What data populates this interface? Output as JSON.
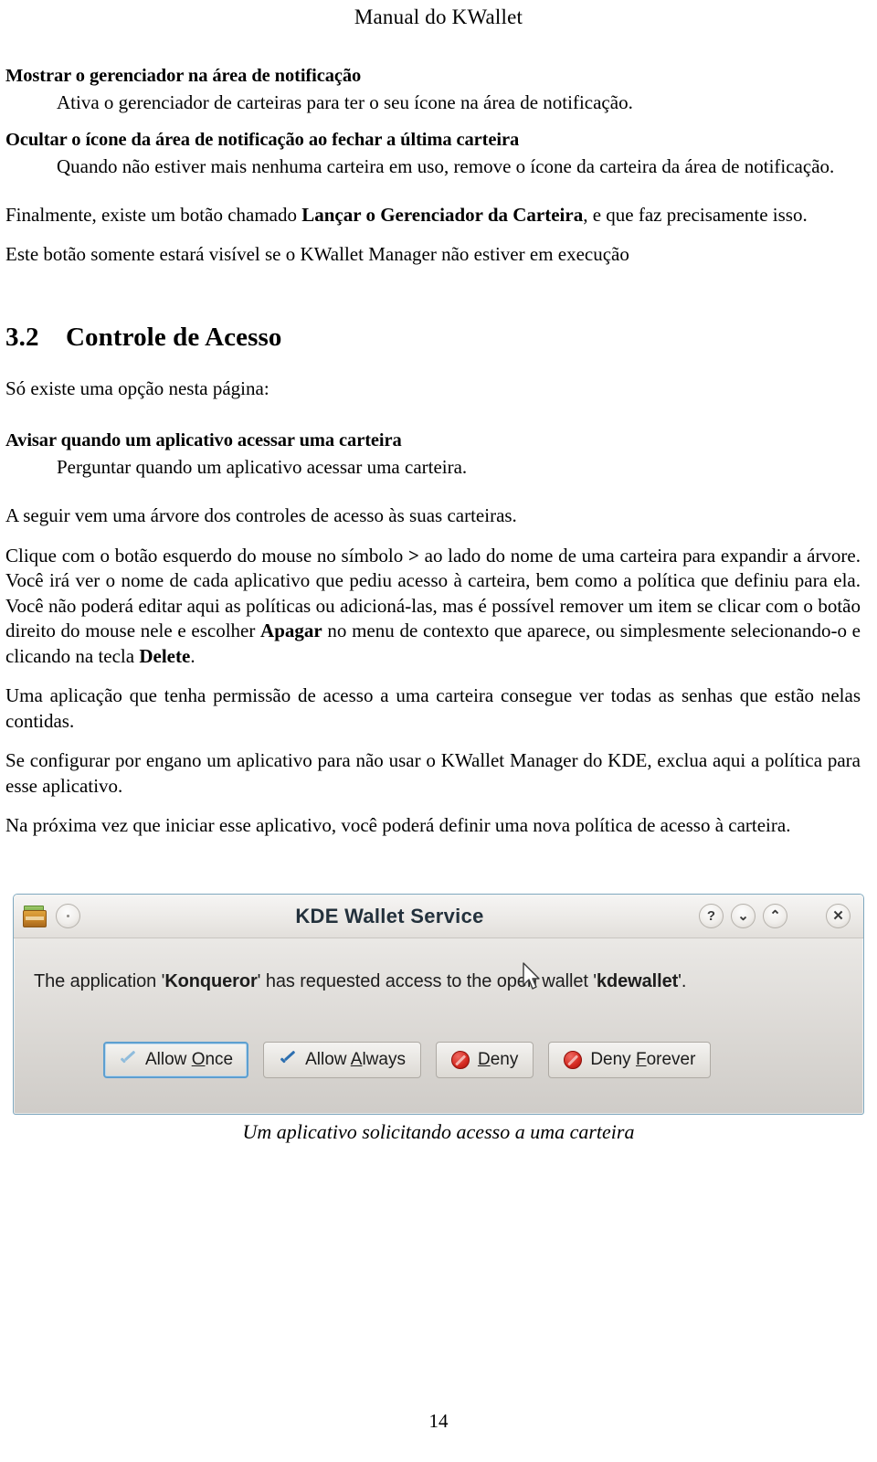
{
  "header": {
    "running_title": "Manual do KWallet"
  },
  "body": {
    "varlist": [
      {
        "term": "Mostrar o gerenciador na área de notificação",
        "definition": "Ativa o gerenciador de carteiras para ter o seu ícone na área de notificação."
      },
      {
        "term": "Ocultar o ícone da área de notificação ao fechar a última carteira",
        "definition": "Quando não estiver mais nenhuma carteira em uso, remove o ícone da carteira da área de notificação."
      }
    ],
    "para_final_1": "Finalmente, existe um botão chamado ",
    "para_final_bold": "Lançar o Gerenciador da Carteira",
    "para_final_2": ", e que faz precisamente isso.",
    "para_visible": "Este botão somente estará visível se o KWallet Manager não estiver em execução"
  },
  "section": {
    "number": "3.2",
    "title": "Controle de Acesso",
    "intro": "Só existe uma opção nesta página:",
    "option_term": "Avisar quando um aplicativo acessar uma carteira",
    "option_def": "Perguntar quando um aplicativo acessar uma carteira.",
    "para_tree": "A seguir vem uma árvore dos controles de acesso às suas carteiras.",
    "para_click_1": "Clique com o botão esquerdo do mouse no símbolo ",
    "para_click_symbol": ">",
    "para_click_2": " ao lado do nome de uma carteira para expandir a árvore. Você irá ver o nome de cada aplicativo que pediu acesso à carteira, bem como a política que definiu para ela. Você não poderá editar aqui as políticas ou adicioná-las, mas é possível remover um item se clicar com o botão direito do mouse nele e escolher ",
    "para_click_bold1": "Apagar",
    "para_click_3": " no menu de contexto que aparece, ou simplesmente selecionando-o e clicando na tecla ",
    "para_click_bold2": "Delete",
    "para_click_4": ".",
    "para_permission": "Uma aplicação que tenha permissão de acesso a uma carteira consegue ver todas as senhas que estão nelas contidas.",
    "para_misconfig": "Se configurar por engano um aplicativo para não usar o KWallet Manager do KDE, exclua aqui a política para esse aplicativo.",
    "para_nexttime": "Na próxima vez que iniciar esse aplicativo, você poderá definir uma nova política de acesso à carteira."
  },
  "figure": {
    "caption": "Um aplicativo solicitando acesso a uma carteira",
    "dialog": {
      "title": "KDE Wallet Service",
      "titlebar_icons": {
        "app": "wallet-icon",
        "menu": "window-menu-dot-icon",
        "help": "?",
        "shade": "⌄",
        "unshade": "⌃",
        "close": "✕"
      },
      "message_1": "The application '",
      "message_app": "Konqueror",
      "message_2": "' has requested access to the open wallet '",
      "message_wallet": "kdewallet",
      "message_3": "'.",
      "buttons": [
        {
          "label_pre": "Allow ",
          "label_key": "O",
          "label_post": "nce",
          "icon": "check-light-icon",
          "focused": true
        },
        {
          "label_pre": "Allow ",
          "label_key": "A",
          "label_post": "lways",
          "icon": "check-dark-icon",
          "focused": false
        },
        {
          "label_pre": "",
          "label_key": "D",
          "label_post": "eny",
          "icon": "deny-icon",
          "focused": false
        },
        {
          "label_pre": "Deny ",
          "label_key": "F",
          "label_post": "orever",
          "icon": "deny-icon",
          "focused": false
        }
      ]
    }
  },
  "footer": {
    "page_number": "14"
  },
  "colors": {
    "dialog_border": "#7fa8bf",
    "focus_ring": "#5d9fd0",
    "deny_red": "#d52b22",
    "check_blue": "#2d6fb0",
    "title_text": "#23313c"
  }
}
